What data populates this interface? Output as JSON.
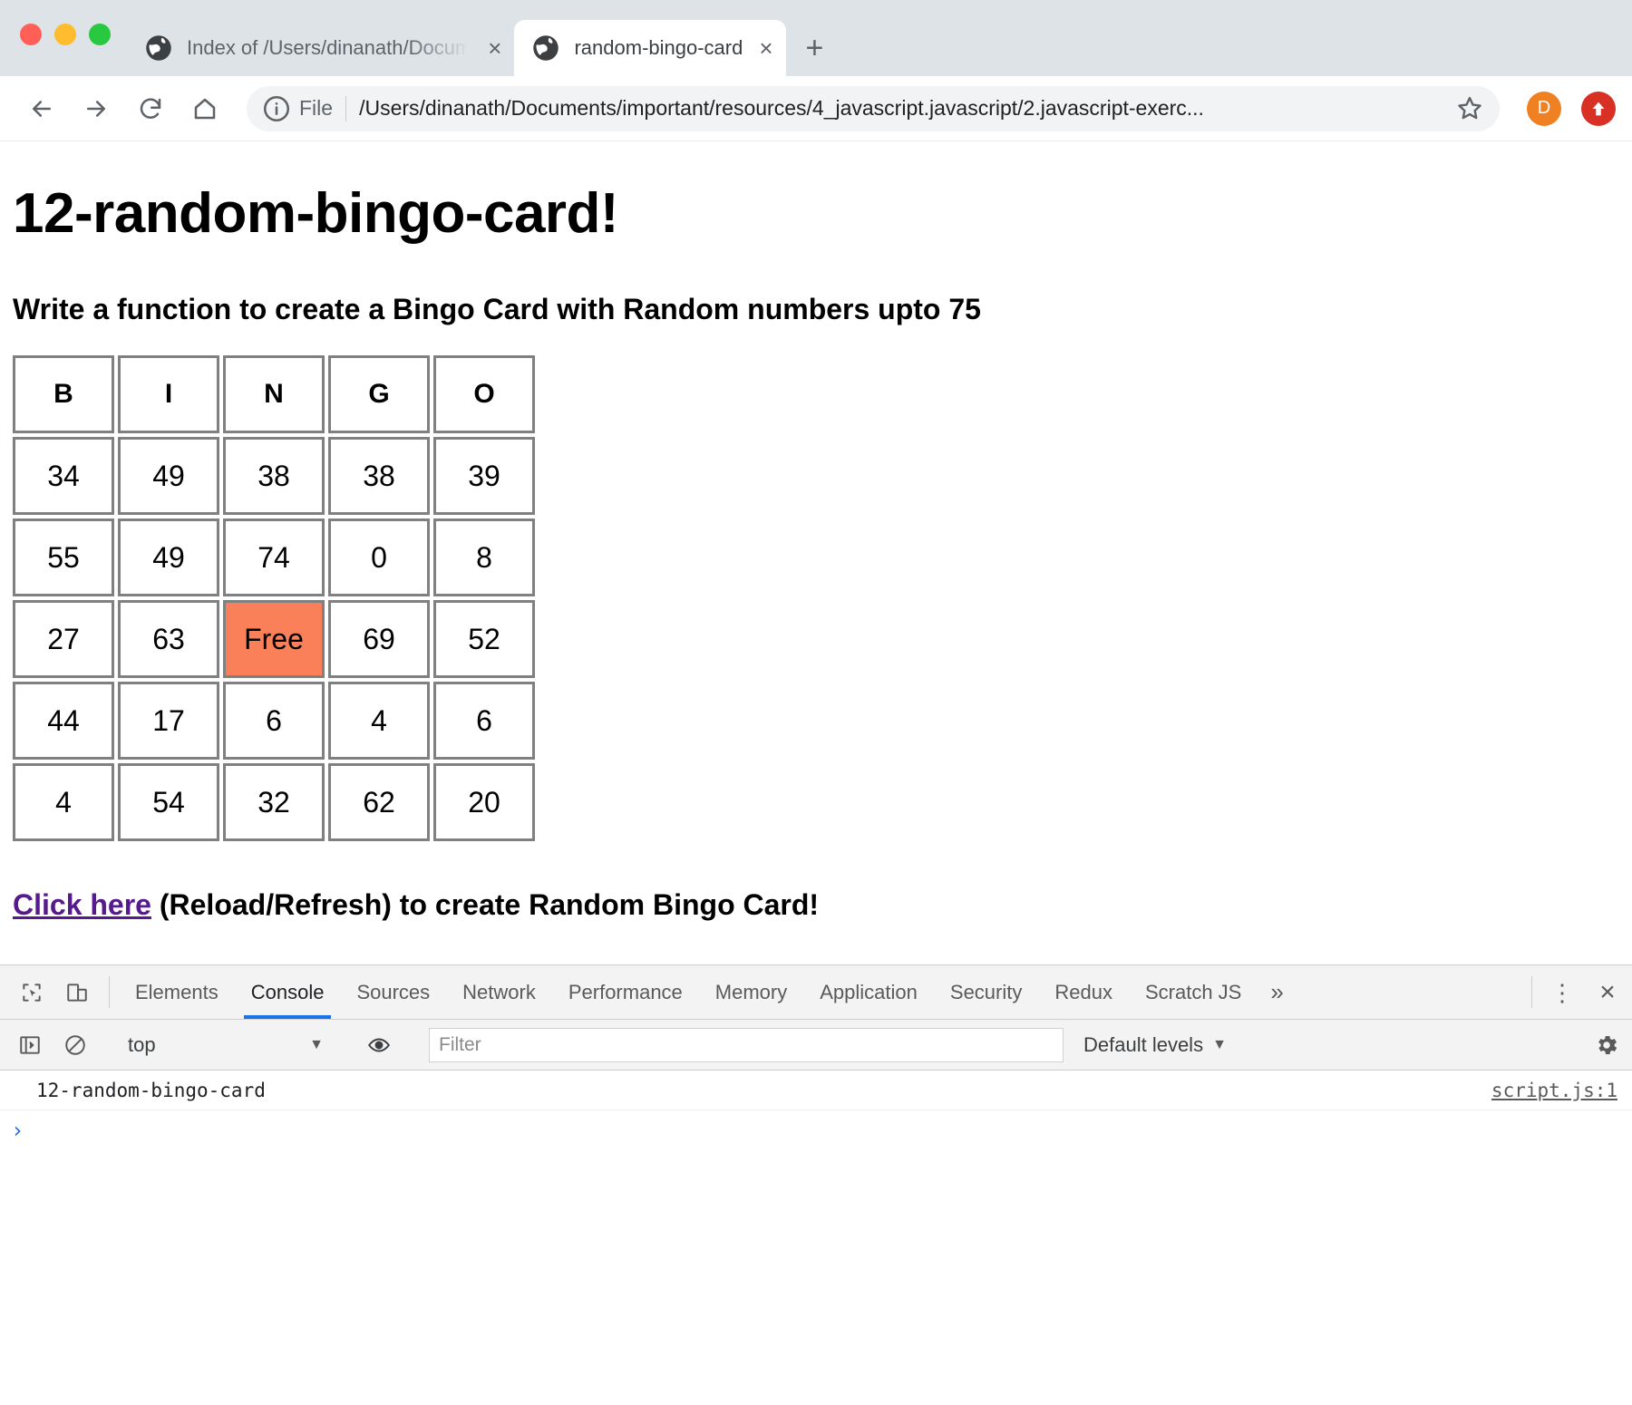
{
  "browser": {
    "window_controls": [
      "close",
      "minimize",
      "maximize"
    ],
    "tabs": [
      {
        "title": "Index of /Users/dinanath/Docum",
        "favicon": "globe-icon",
        "active": false,
        "close_label": "×"
      },
      {
        "title": "random-bingo-card",
        "favicon": "globe-icon",
        "active": true,
        "close_label": "×"
      }
    ],
    "new_tab_label": "+",
    "toolbar": {
      "back_label": "Back",
      "forward_label": "Forward",
      "reload_label": "Reload",
      "home_label": "Home",
      "scheme_label": "File",
      "url": "/Users/dinanath/Documents/important/resources/4_javascript.javascript/2.javascript-exerc...",
      "bookmark_label": "Bookmark this page",
      "avatar_letter": "D",
      "avatar_color": "#ef8122",
      "update_color": "#d93025"
    }
  },
  "page": {
    "title": "12-random-bingo-card!",
    "subtitle": "Write a function to create a Bingo Card with Random numbers upto 75",
    "cta": {
      "link_text": "Click here",
      "rest_text": " (Reload/Refresh) to create Random Bingo Card!",
      "link_color": "#551a8b"
    },
    "bingo": {
      "headers": [
        "B",
        "I",
        "N",
        "G",
        "O"
      ],
      "free_cell": {
        "row": 3,
        "col": 2,
        "label": "Free",
        "color": "#fa8059"
      },
      "rows": [
        [
          "34",
          "49",
          "38",
          "38",
          "39"
        ],
        [
          "55",
          "49",
          "74",
          "0",
          "8"
        ],
        [
          "27",
          "63",
          "Free",
          "69",
          "52"
        ],
        [
          "44",
          "17",
          "6",
          "4",
          "6"
        ],
        [
          "4",
          "54",
          "32",
          "62",
          "20"
        ]
      ]
    }
  },
  "devtools": {
    "inspect_icon": "inspect-element-icon",
    "device_icon": "device-toolbar-icon",
    "tabs": [
      {
        "label": "Elements",
        "active": false
      },
      {
        "label": "Console",
        "active": true
      },
      {
        "label": "Sources",
        "active": false
      },
      {
        "label": "Network",
        "active": false
      },
      {
        "label": "Performance",
        "active": false
      },
      {
        "label": "Memory",
        "active": false
      },
      {
        "label": "Application",
        "active": false
      },
      {
        "label": "Security",
        "active": false
      },
      {
        "label": "Redux",
        "active": false
      },
      {
        "label": "Scratch JS",
        "active": false
      }
    ],
    "more_tabs_label": "»",
    "kebab_label": "⋮",
    "close_label": "×",
    "active_tab_underline_color": "#1a73e8",
    "console": {
      "sidebar_toggle_icon": "console-sidebar-icon",
      "clear_icon": "clear-console-icon",
      "context": "top",
      "context_caret": "▼",
      "eye_icon": "live-expression-icon",
      "filter_placeholder": "Filter",
      "filter_value": "",
      "levels_label": "Default levels",
      "levels_caret": "▼",
      "settings_icon": "gear-icon",
      "messages": [
        {
          "text": "12-random-bingo-card",
          "source": "script.js:1"
        }
      ],
      "prompt_symbol": "›"
    }
  }
}
